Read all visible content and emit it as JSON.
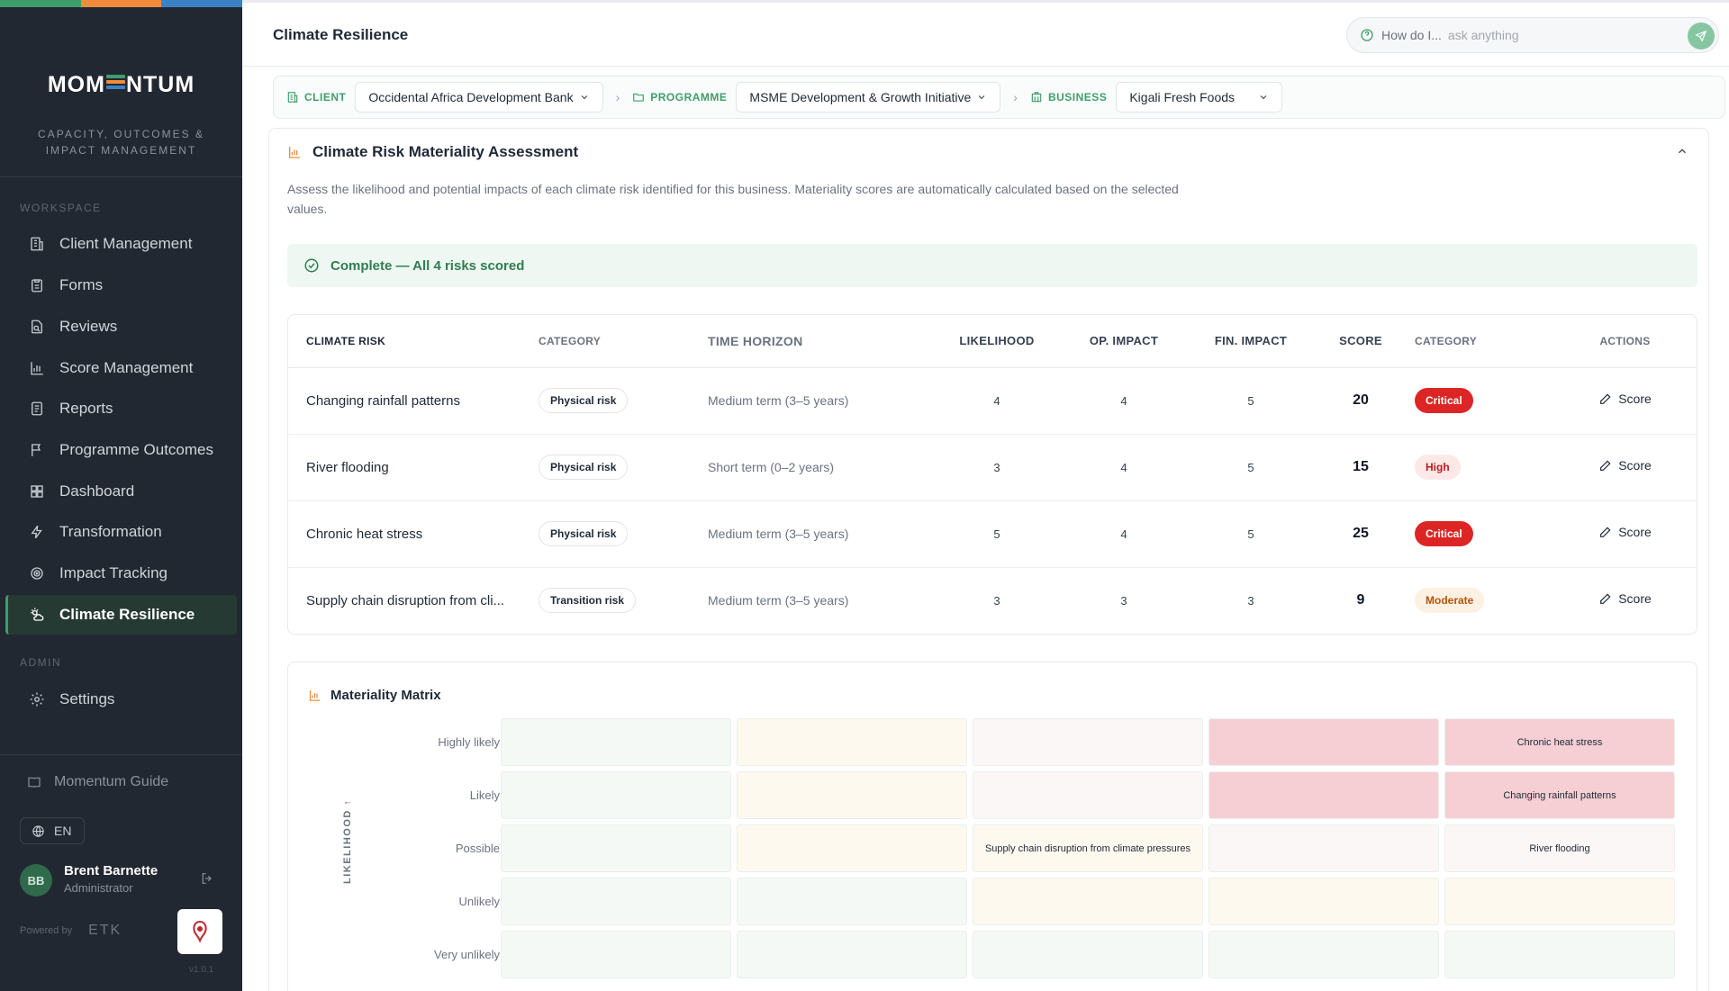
{
  "app": {
    "logo": "MOMENTUM",
    "tagline_line1": "CAPACITY, OUTCOMES &",
    "tagline_line2": "IMPACT MANAGEMENT",
    "brand_colors": [
      "#3f9e6b",
      "#f08a3c",
      "#3b82c4"
    ]
  },
  "sidebar": {
    "workspace_label": "WORKSPACE",
    "items": [
      {
        "label": "Client Management",
        "icon": "building-icon"
      },
      {
        "label": "Forms",
        "icon": "clipboard-icon"
      },
      {
        "label": "Reviews",
        "icon": "review-icon"
      },
      {
        "label": "Score Management",
        "icon": "bar-chart-icon"
      },
      {
        "label": "Reports",
        "icon": "report-icon"
      },
      {
        "label": "Programme Outcomes",
        "icon": "flag-icon"
      },
      {
        "label": "Dashboard",
        "icon": "grid-icon"
      },
      {
        "label": "Transformation",
        "icon": "lightning-icon"
      },
      {
        "label": "Impact Tracking",
        "icon": "target-icon"
      },
      {
        "label": "Climate Resilience",
        "icon": "sun-cloud-icon",
        "active": true
      }
    ],
    "admin_label": "ADMIN",
    "settings_label": "Settings",
    "guide_label": "Momentum Guide",
    "language": "EN",
    "user": {
      "initials": "BB",
      "name": "Brent Barnette",
      "role": "Administrator"
    },
    "powered_by": "Powered by",
    "powered_brand": "ETK",
    "version": "v1.0.1"
  },
  "topbar": {
    "title": "Climate Resilience",
    "ask_prefix": "How do I...",
    "ask_placeholder": "ask anything"
  },
  "breadcrumb": {
    "client_label": "CLIENT",
    "client_value": "Occidental Africa Development Bank",
    "programme_label": "PROGRAMME",
    "programme_value": "MSME Development & Growth Initiative",
    "business_label": "BUSINESS",
    "business_value": "Kigali Fresh Foods"
  },
  "assessment": {
    "title": "Climate Risk Materiality Assessment",
    "description": "Assess the likelihood and potential impacts of each climate risk identified for this business. Materiality scores are automatically calculated based on the selected values.",
    "status": "Complete — All 4 risks scored",
    "columns": [
      "CLIMATE RISK",
      "CATEGORY",
      "TIME HORIZON",
      "LIKELIHOOD",
      "OP. IMPACT",
      "FIN. IMPACT",
      "SCORE",
      "CATEGORY",
      "ACTIONS"
    ],
    "rows": [
      {
        "risk": "Changing rainfall patterns",
        "category": "Physical risk",
        "horizon": "Medium term (3–5 years)",
        "likelihood": "4",
        "op_impact": "4",
        "fin_impact": "5",
        "score": "20",
        "level": "Critical",
        "action": "Score"
      },
      {
        "risk": "River flooding",
        "category": "Physical risk",
        "horizon": "Short term (0–2 years)",
        "likelihood": "3",
        "op_impact": "4",
        "fin_impact": "5",
        "score": "15",
        "level": "High",
        "action": "Score"
      },
      {
        "risk": "Chronic heat stress",
        "category": "Physical risk",
        "horizon": "Medium term (3–5 years)",
        "likelihood": "5",
        "op_impact": "4",
        "fin_impact": "5",
        "score": "25",
        "level": "Critical",
        "action": "Score"
      },
      {
        "risk": "Supply chain disruption from cli...",
        "category": "Transition risk",
        "horizon": "Medium term (3–5 years)",
        "likelihood": "3",
        "op_impact": "3",
        "fin_impact": "3",
        "score": "9",
        "level": "Moderate",
        "action": "Score"
      }
    ]
  },
  "matrix": {
    "title": "Materiality Matrix",
    "y_axis_label": "LIKELIHOOD ↑",
    "rows": [
      "Highly likely",
      "Likely",
      "Possible",
      "Unlikely",
      "Very unlikely"
    ],
    "cells": [
      [
        "",
        "",
        "",
        "",
        "Chronic heat stress"
      ],
      [
        "",
        "",
        "",
        "",
        "Changing rainfall patterns"
      ],
      [
        "",
        "",
        "Supply chain disruption from climate pressures",
        "",
        "River flooding"
      ],
      [
        "",
        "",
        "",
        "",
        ""
      ],
      [
        "",
        "",
        "",
        "",
        ""
      ]
    ],
    "cell_colors": [
      [
        "#f4f9f5",
        "#fdf9ef",
        "#fbf7f6",
        "#f5cfd3",
        "#f5cfd3"
      ],
      [
        "#f4f9f5",
        "#fdf9ef",
        "#fbf7f6",
        "#f5cfd3",
        "#f5cfd3"
      ],
      [
        "#f4f9f5",
        "#fdf9ef",
        "#fdf9ef",
        "#fbf7f6",
        "#fbf7f6"
      ],
      [
        "#f4f9f5",
        "#f4f9f5",
        "#fdf9ef",
        "#fdf9ef",
        "#fdf9ef"
      ],
      [
        "#f4f9f5",
        "#f4f9f5",
        "#f4f9f5",
        "#f4f9f5",
        "#f4f9f5"
      ]
    ]
  }
}
